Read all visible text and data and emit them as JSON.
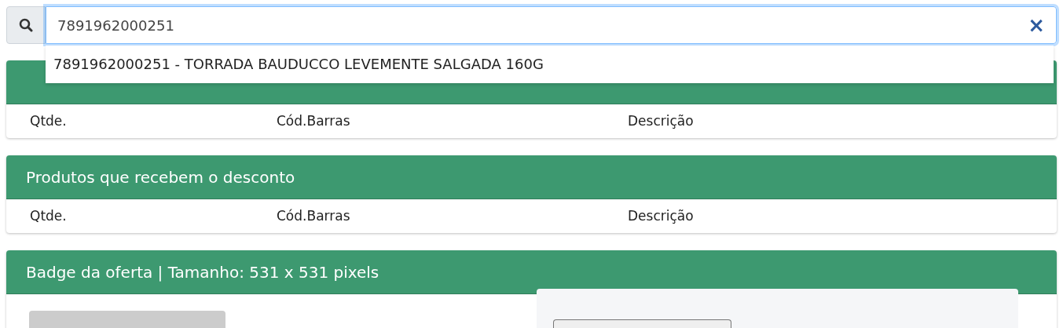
{
  "search": {
    "value": "7891962000251",
    "clear_label": "×"
  },
  "suggestions": [
    "7891962000251 - TORRADA BAUDUCCO LEVEMENTE SALGADA 160G"
  ],
  "panels": [
    {
      "kind": "table",
      "columns": [
        "Qtde.",
        "Cód.Barras",
        "Descrição"
      ]
    },
    {
      "title": "Produtos que recebem o desconto",
      "kind": "table",
      "columns": [
        "Qtde.",
        "Cód.Barras",
        "Descrição"
      ]
    },
    {
      "title": "Badge da oferta | Tamanho: 531 x 531 pixels",
      "kind": "badge"
    }
  ]
}
